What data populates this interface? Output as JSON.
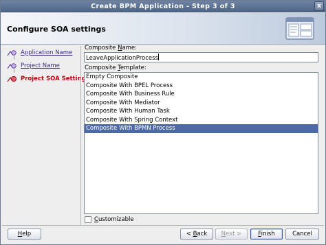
{
  "window": {
    "title": "Create BPM Application - Step 3 of 3",
    "close_glyph": "x"
  },
  "header": {
    "title": "Configure SOA settings",
    "graphic_icon": "wizard-dialog-icon"
  },
  "steps": {
    "items": [
      {
        "label": "Application Name",
        "state": "visited",
        "icon": "step-done-icon"
      },
      {
        "label": "Project Name",
        "state": "visited",
        "icon": "step-done-icon"
      },
      {
        "label": "Project SOA Settings",
        "state": "current",
        "icon": "step-current-icon"
      }
    ]
  },
  "form": {
    "name_label_prefix": "Composite ",
    "name_label_mnemonic": "N",
    "name_label_suffix": "ame:",
    "name_value": "LeaveApplicationProcess",
    "template_label_prefix": "Composite ",
    "template_label_mnemonic": "T",
    "template_label_suffix": "emplate:",
    "templates": [
      "Empty Composite",
      "Composite With BPEL Process",
      "Composite With Business Rule",
      "Composite With Mediator",
      "Composite With Human Task",
      "Composite With Spring Context",
      "Composite With BPMN Process"
    ],
    "selected_template_index": 6,
    "customizable_mnemonic": "C",
    "customizable_rest": "ustomizable",
    "customizable_checked": false
  },
  "buttons": {
    "help_mnemonic": "H",
    "help_rest": "elp",
    "back_prefix": "< ",
    "back_mnemonic": "B",
    "back_rest": "ack",
    "next_mnemonic": "N",
    "next_rest": "ext >",
    "finish_mnemonic": "F",
    "finish_rest": "inish",
    "cancel_label": "Cancel"
  },
  "colors": {
    "selection": "#4e6aa6",
    "link": "#3c2a82",
    "current_step": "#c0000f",
    "titlebar": "#5b7194"
  }
}
